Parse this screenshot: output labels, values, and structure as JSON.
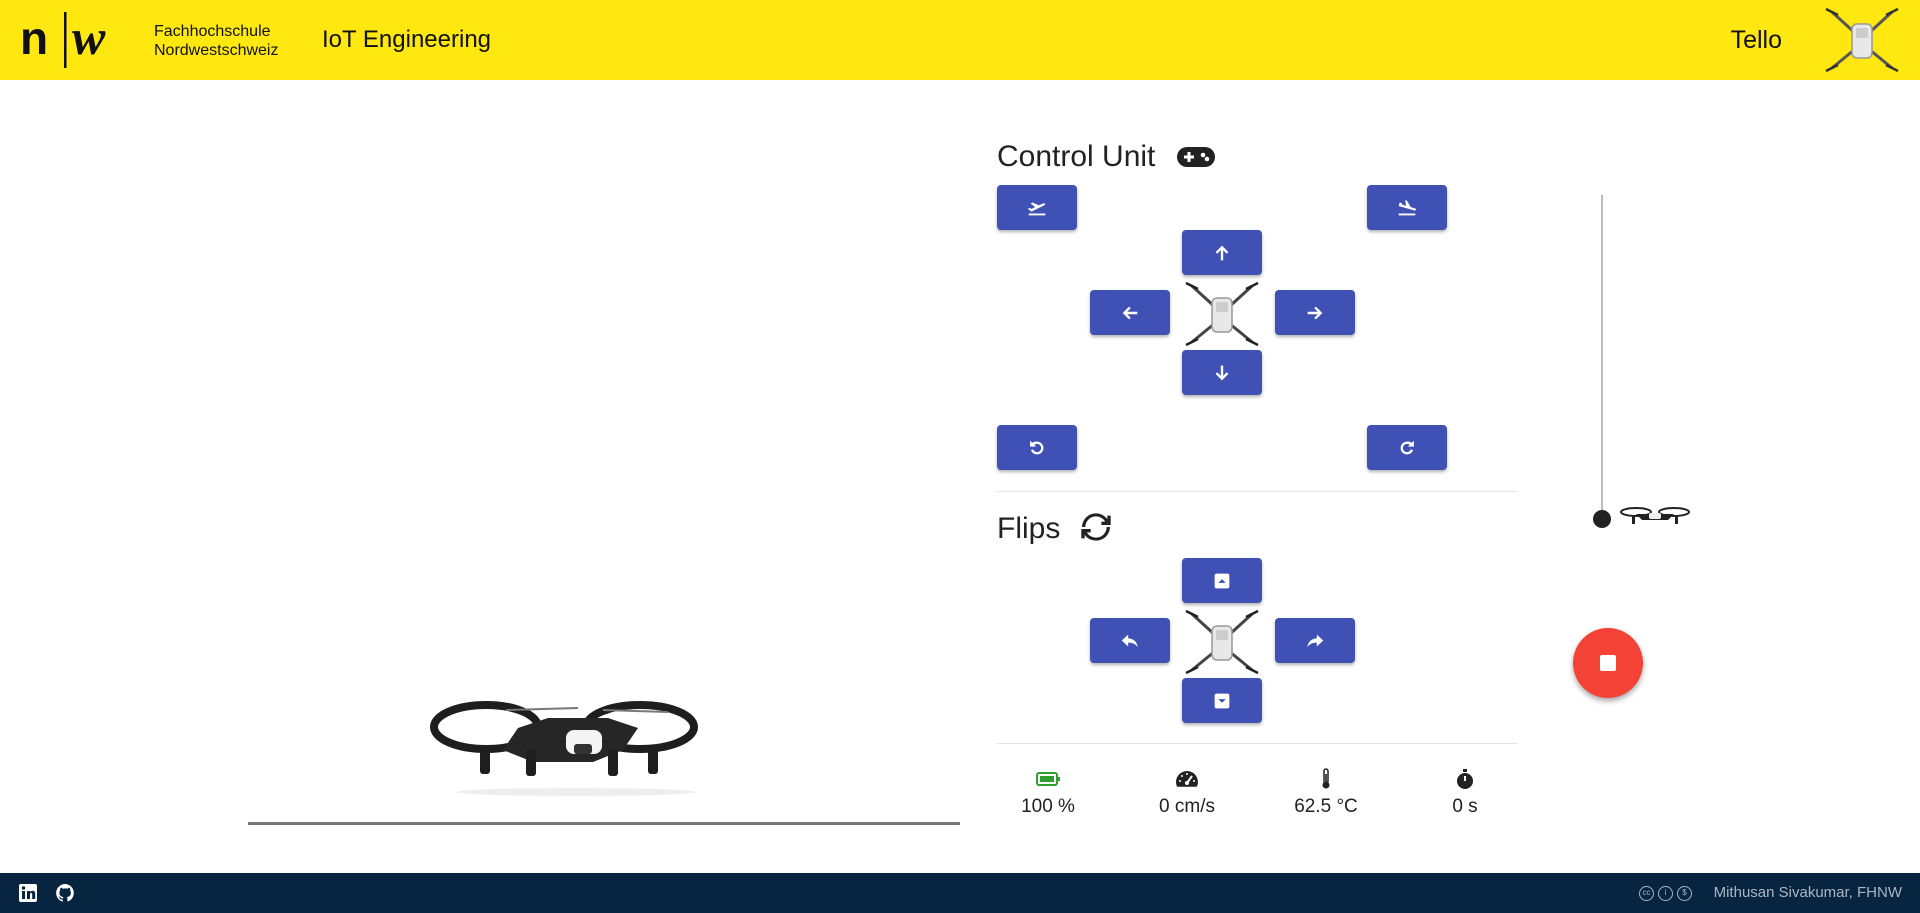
{
  "header": {
    "logo_mark": "n|w",
    "school_line1": "Fachhochschule",
    "school_line2": "Nordwestschweiz",
    "app_title": "IoT Engineering",
    "drone_name": "Tello"
  },
  "control_unit": {
    "title": "Control Unit",
    "title_icon": "gamepad-icon",
    "buttons": [
      "takeoff",
      "land",
      "forward",
      "left",
      "right",
      "back",
      "rotate-ccw",
      "rotate-cw"
    ]
  },
  "flips": {
    "title": "Flips",
    "title_icon": "sync-icon",
    "buttons": [
      "flip-forward",
      "flip-left",
      "flip-right",
      "flip-back"
    ]
  },
  "altitude_slider": {
    "level": 0
  },
  "stats": {
    "battery": "100 %",
    "speed": "0 cm/s",
    "temperature": "62.5 °C",
    "flight_time": "0 s"
  },
  "colors": {
    "header_bg": "#ffe80f",
    "button": "#3f51b5",
    "stop_fab": "#f44336",
    "footer_bg": "#072540",
    "battery_ok": "#2e9e2e"
  },
  "footer": {
    "icons": [
      "linkedin-icon",
      "github-icon",
      "cc-icon",
      "by-icon",
      "nc-icon"
    ],
    "credit": "Mithusan Sivakumar, FHNW"
  }
}
